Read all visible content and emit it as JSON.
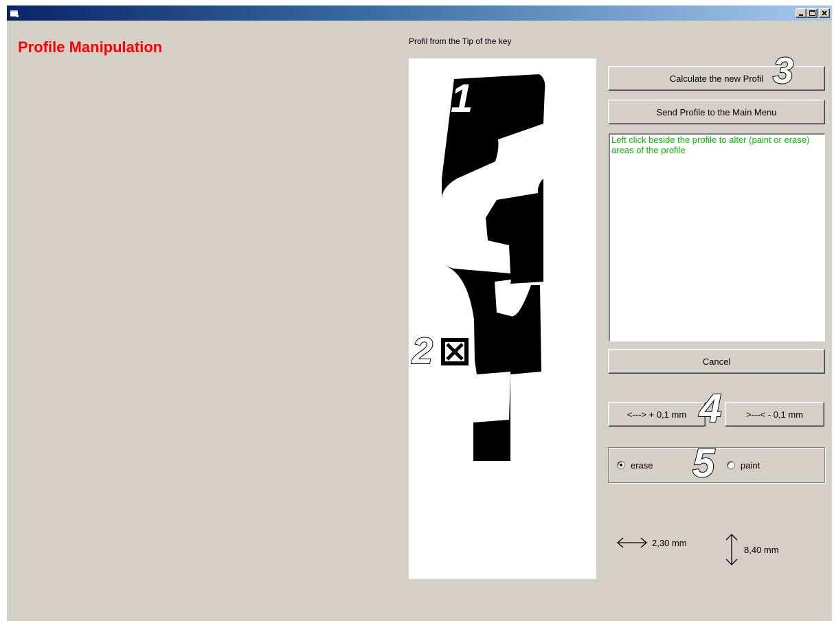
{
  "window": {
    "icon": "app-window-icon",
    "controls": [
      "minimize-icon",
      "maximize-icon",
      "close-icon"
    ]
  },
  "form": {
    "title": "Profile Manipulation",
    "title_color": "#ff0000"
  },
  "profile": {
    "caption": "Profil from the Tip of the key"
  },
  "buttons": {
    "calculate": "Calculate the new Profil",
    "send": "Send Profile to the Main Menu",
    "cancel": "Cancel",
    "plus": "<---> + 0,1 mm",
    "minus": ">---< - 0,1 mm"
  },
  "message": {
    "text": "Left click beside the profile to alter (paint or erase) areas of the profile",
    "color": "#00c000"
  },
  "mode": {
    "options": [
      "erase",
      "paint"
    ],
    "selected": "erase"
  },
  "dimensions": {
    "width": "2,30 mm",
    "height": "8,40 mm"
  },
  "callouts": [
    "1",
    "2",
    "3",
    "4",
    "5"
  ]
}
